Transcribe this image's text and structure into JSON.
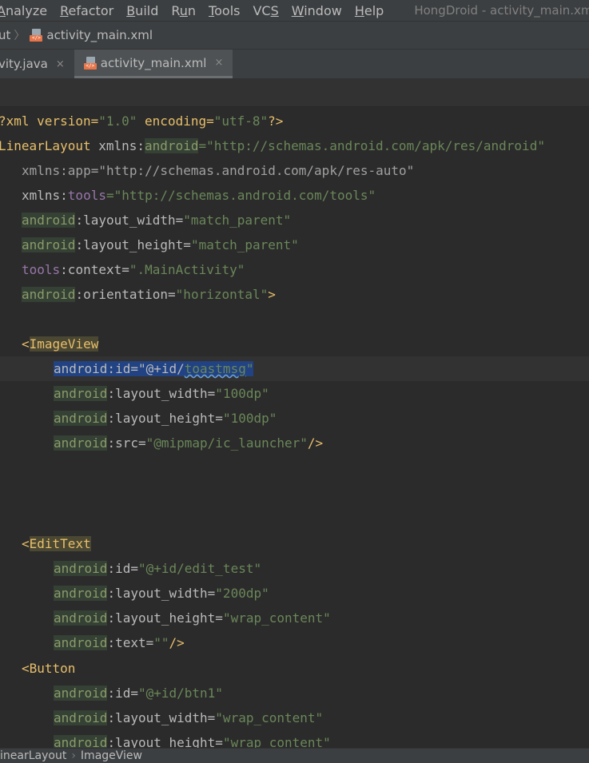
{
  "menu": [
    {
      "label": "Analyze",
      "mnemonic": "A"
    },
    {
      "label": "Refactor",
      "mnemonic": "R"
    },
    {
      "label": "Build",
      "mnemonic": "B"
    },
    {
      "label": "Run",
      "mnemonic": "u"
    },
    {
      "label": "Tools",
      "mnemonic": "T"
    },
    {
      "label": "VCS",
      "mnemonic": "S"
    },
    {
      "label": "Window",
      "mnemonic": "W"
    },
    {
      "label": "Help",
      "mnemonic": "H"
    }
  ],
  "window_title": "HongDroid - activity_main.xml [HongDr",
  "nav": {
    "first": "ut",
    "file": "activity_main.xml"
  },
  "tabs": [
    {
      "label": "vity.java",
      "close": "×"
    },
    {
      "label": "activity_main.xml",
      "close": "×"
    }
  ],
  "code": {
    "l1": [
      "?xml version=",
      "\"1.0\"",
      " encoding=",
      "\"utf-8\"",
      "?>"
    ],
    "l2": [
      "LinearLayout",
      " xmlns:",
      "android",
      "=",
      "\"http://schemas.android.com/apk/res/android\""
    ],
    "l3": [
      "xmlns:app=\"http://schemas.android.com/apk/res-auto\""
    ],
    "l4": [
      "xmlns:",
      "tools",
      "=",
      "\"http://schemas.android.com/tools\""
    ],
    "l5": [
      "android",
      ":layout_width=",
      "\"match_parent\""
    ],
    "l6": [
      "android",
      ":layout_height=",
      "\"match_parent\""
    ],
    "l7": [
      "tools",
      ":context=",
      "\".MainActivity\""
    ],
    "l8": [
      "android",
      ":orientation=",
      "\"horizontal\"",
      ">"
    ],
    "l10": [
      "<",
      "ImageView"
    ],
    "l11": [
      "android:id=\"@+id/",
      "toastmsg",
      "\""
    ],
    "l12": [
      "android",
      ":layout_width=",
      "\"100dp\""
    ],
    "l13": [
      "android",
      ":layout_height=",
      "\"100dp\""
    ],
    "l14": [
      "android",
      ":src=",
      "\"@mipmap/ic_launcher\"",
      "/>"
    ],
    "l18": [
      "<",
      "EditText"
    ],
    "l19": [
      "android",
      ":id=",
      "\"@+id/edit_test\""
    ],
    "l20": [
      "android",
      ":layout_width=",
      "\"200dp\""
    ],
    "l21": [
      "android",
      ":layout_height=",
      "\"wrap_content\""
    ],
    "l22": [
      "android",
      ":text=",
      "\"\"",
      "/>"
    ],
    "l23": [
      "<",
      "Button"
    ],
    "l24": [
      "android",
      ":id=",
      "\"@+id/btn1\""
    ],
    "l25": [
      "android",
      ":layout_width=",
      "\"wrap_content\""
    ],
    "l26": [
      "android",
      ":layout_height=",
      "\"wrap_content\""
    ]
  },
  "breadcrumb": [
    "inearLayout",
    "ImageView"
  ]
}
